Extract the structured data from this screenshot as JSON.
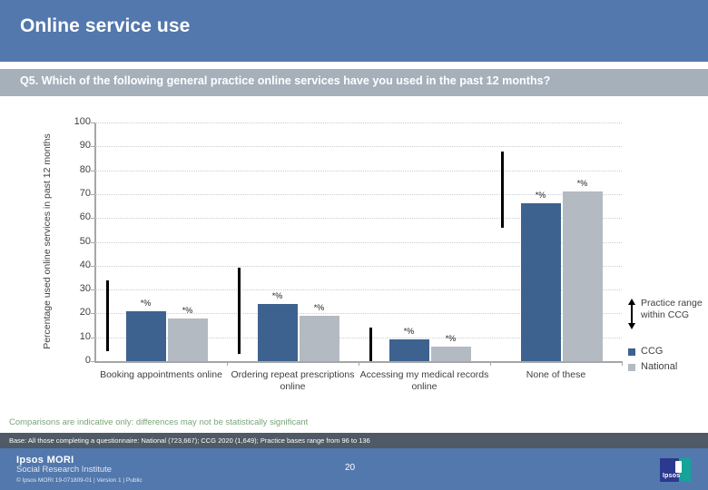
{
  "slide": {
    "title": "Online service use",
    "question": "Q5. Which of the following general practice online services have you used in the past 12 months?",
    "note": "Comparisons are indicative only: differences may not be statistically significant",
    "base": "Base: All those completing a questionnaire: National (723,667); CCG 2020 (1,649); Practice bases range from 96 to 136",
    "page_number": "20",
    "colors": {
      "banner": "#5278ad",
      "question_bar": "#a6b0bb",
      "ccg": "#3e628f",
      "national": "#b4bac1",
      "range": "#000000",
      "note_text": "#7aa47a",
      "base_bar": "#4f5a66"
    }
  },
  "footer": {
    "brand_line1": "Ipsos MORI",
    "brand_line2": "Social Research Institute",
    "copyright": "© Ipsos MORI      19-071809-01 | Version 1 | Public",
    "logo_word": "Ipsos"
  },
  "legend": {
    "range_label": "Practice range within CCG",
    "items": [
      {
        "label": "CCG",
        "color": "#3e628f"
      },
      {
        "label": "National",
        "color": "#b4bac1"
      }
    ]
  },
  "chart_data": {
    "type": "bar",
    "title": "Q5. Which of the following general practice online services have you used in the past 12 months?",
    "xlabel": "",
    "ylabel": "Percentage used online services in past 12 months",
    "ylim": [
      0,
      100
    ],
    "yticks": [
      0,
      10,
      20,
      30,
      40,
      50,
      60,
      70,
      80,
      90,
      100
    ],
    "ytick_labels": [
      "0",
      "10",
      "20",
      "30",
      "40",
      "50",
      "60",
      "70",
      "80",
      "90",
      "100"
    ],
    "grid": true,
    "legend_position": "right",
    "categories": [
      "Booking appointments online",
      "Ordering repeat prescriptions online",
      "Accessing my medical records online",
      "None of these"
    ],
    "series": [
      {
        "name": "CCG",
        "color": "#3e628f",
        "values": [
          21,
          24,
          9,
          66
        ]
      },
      {
        "name": "National",
        "color": "#b4bac1",
        "values": [
          18,
          19,
          6,
          71
        ]
      }
    ],
    "data_labels": {
      "CCG": [
        "*%",
        "*%",
        "*%",
        "*%"
      ],
      "National": [
        "*%",
        "*%",
        "*%",
        "*%"
      ]
    },
    "practice_range": [
      {
        "category": "Booking appointments online",
        "low": 4,
        "high": 34
      },
      {
        "category": "Ordering repeat prescriptions online",
        "low": 3,
        "high": 39
      },
      {
        "category": "Accessing my medical records online",
        "low": 0,
        "high": 14
      },
      {
        "category": "None of these",
        "low": 56,
        "high": 88
      }
    ]
  }
}
